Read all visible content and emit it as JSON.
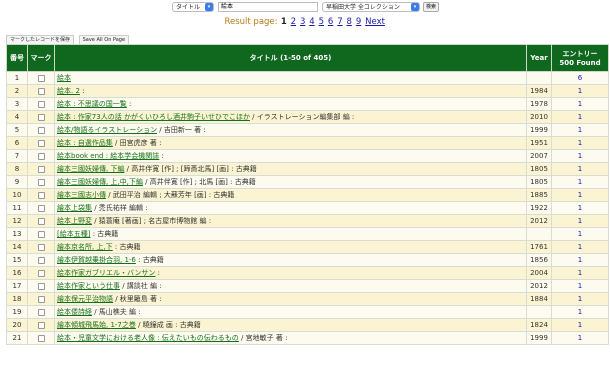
{
  "search": {
    "field_select": "タイトル",
    "query": "絵本",
    "library_select": "早稲田大学 全コレクション",
    "search_button": "検索"
  },
  "result": {
    "label": "Result page:",
    "pages": [
      "1",
      "2",
      "3",
      "4",
      "5",
      "6",
      "7",
      "8",
      "9"
    ],
    "next": "Next"
  },
  "actions": {
    "save_marked": "マークしたレコードを保存",
    "save_all": "Save All On Page"
  },
  "table": {
    "headers": {
      "num": "番号",
      "mark": "マーク",
      "title": "タイトル (1-50 of 405)",
      "year": "Year",
      "entries_line1": "エントリー",
      "entries_line2": "500 Found"
    },
    "rows": [
      {
        "num": "1",
        "link": "絵本",
        "rest": "",
        "year": "",
        "count": "6"
      },
      {
        "num": "2",
        "link": "絵本. 2",
        "rest": " :",
        "year": "1984",
        "count": "1"
      },
      {
        "num": "3",
        "link": "絵本 : 不思議の国一覧",
        "rest": " :",
        "year": "1978",
        "count": "1"
      },
      {
        "num": "4",
        "link": "絵本 : 作家73人の話 かがくいひろし酒井駒子いせひでこほか",
        "rest": " / イラストレーション編集部 編 :",
        "year": "2010",
        "count": "1"
      },
      {
        "num": "5",
        "link": "絵本/物語るイラストレーション",
        "rest": " / 吉田新一 著 :",
        "year": "1999",
        "count": "1"
      },
      {
        "num": "6",
        "link": "絵本 : 自選作品集",
        "rest": " / 田宮虎彦 著 :",
        "year": "1951",
        "count": "1"
      },
      {
        "num": "7",
        "link": "絵本book end : 絵本学会機関誌",
        "rest": " :",
        "year": "2007",
        "count": "1"
      },
      {
        "num": "8",
        "link": "繪本三國妖婦傳, 下編",
        "rest": " / 高井伴寛 [作] ; [蹄斎北馬] [画] : 古典籍",
        "year": "1805",
        "count": "1"
      },
      {
        "num": "9",
        "link": "繪本三國妖婦傳, 上,中,下編",
        "rest": " / 高井伴寛 [作] ; 北馬 [画] : 古典籍",
        "year": "1805",
        "count": "1"
      },
      {
        "num": "10",
        "link": "繪本三國志小傳",
        "rest": " / 武田平治 編輯 ; 大蘇芳年 [画] : 古典籍",
        "year": "1885",
        "count": "1"
      },
      {
        "num": "11",
        "link": "繪本上袋集",
        "rest": " / 禿氏祐祥 編輯 :",
        "year": "1922",
        "count": "1"
      },
      {
        "num": "12",
        "link": "絵本上野変",
        "rest": " / 猿蓑庵 [著画] ; 名古屋市博物館 編 :",
        "year": "2012",
        "count": "1"
      },
      {
        "num": "13",
        "link": "[絵本五種]",
        "rest": " : 古典籍",
        "year": "",
        "count": "1"
      },
      {
        "num": "14",
        "link": "繪本京名所, 上,下",
        "rest": " : 古典籍",
        "year": "1761",
        "count": "1"
      },
      {
        "num": "15",
        "link": "繪本伊賀越乗掛合羽, 1-6",
        "rest": " : 古典籍",
        "year": "1856",
        "count": "1"
      },
      {
        "num": "16",
        "link": "絵本作家ガブリエル・バンサン",
        "rest": " :",
        "year": "2004",
        "count": "1"
      },
      {
        "num": "17",
        "link": "絵本作家という仕事",
        "rest": " / 講談社 編 :",
        "year": "2012",
        "count": "1"
      },
      {
        "num": "18",
        "link": "繪本保元平治物語",
        "rest": " / 秋里籬島 著 :",
        "year": "1884",
        "count": "1"
      },
      {
        "num": "19",
        "link": "絵本倭詩経",
        "rest": " / 馬山樵夫 編 :",
        "year": "",
        "count": "1"
      },
      {
        "num": "20",
        "link": "繪本傾城飛馬始, 1-7之巻",
        "rest": " / 曉鐘成 画 : 古典籍",
        "year": "1824",
        "count": "1"
      },
      {
        "num": "21",
        "link": "絵本・児童文学における老人像 : 伝えたいもの伝わるもの",
        "rest": " / 宮地敏子 著 :",
        "year": "1999",
        "count": "1"
      }
    ]
  }
}
